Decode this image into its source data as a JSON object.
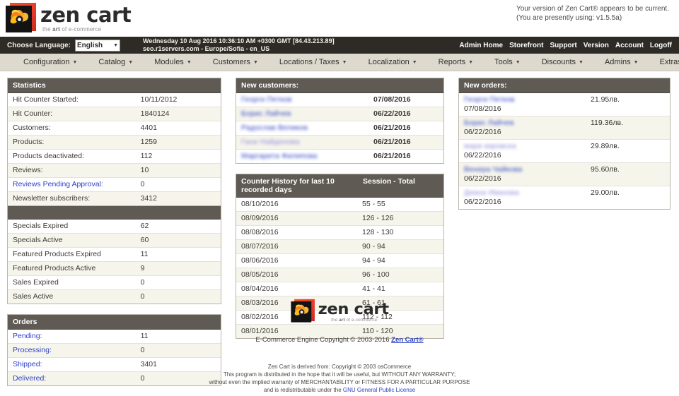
{
  "branding": {
    "name": "zen cart",
    "tagline_plain1": "the ",
    "tagline_bold": "art",
    "tagline_plain2": " of e-commerce",
    "logo_icon": "zencart-spiral-logo"
  },
  "version_notice": {
    "line1": "Your version of Zen Cart® appears to be current.",
    "line2": "(You are presently using: v1.5.5a)"
  },
  "adminbar": {
    "language_label": "Choose Language:",
    "language_value": "English",
    "datetime_line1": "Wednesday 10 Aug 2016 10:36:10 AM +0300 GMT [84.43.213.89]",
    "datetime_line2": "seo.r1servers.com - Europe/Sofia - en_US",
    "links": [
      {
        "label": "Admin Home"
      },
      {
        "label": "Storefront"
      },
      {
        "label": "Support"
      },
      {
        "label": "Version"
      },
      {
        "label": "Account"
      },
      {
        "label": "Logoff"
      }
    ]
  },
  "menu": [
    {
      "label": "Configuration"
    },
    {
      "label": "Catalog"
    },
    {
      "label": "Modules"
    },
    {
      "label": "Customers"
    },
    {
      "label": "Locations / Taxes"
    },
    {
      "label": "Localization"
    },
    {
      "label": "Reports"
    },
    {
      "label": "Tools"
    },
    {
      "label": "Discounts"
    },
    {
      "label": "Admins"
    },
    {
      "label": "Extras"
    }
  ],
  "statistics": {
    "title": "Statistics",
    "rows": [
      {
        "label": "Hit Counter Started:",
        "value": "10/11/2012",
        "link": false
      },
      {
        "label": "Hit Counter:",
        "value": "1840124",
        "link": false
      },
      {
        "label": "Customers:",
        "value": "4401",
        "link": false
      },
      {
        "label": "Products:",
        "value": "1259",
        "link": false
      },
      {
        "label": "Products deactivated:",
        "value": "112",
        "link": false
      },
      {
        "label": "Reviews:",
        "value": "10",
        "link": false
      },
      {
        "label": "Reviews Pending Approval:",
        "value": "0",
        "link": true
      },
      {
        "label": "Newsletter subscribers:",
        "value": "3412",
        "link": false
      }
    ]
  },
  "specials": {
    "title": "",
    "rows": [
      {
        "label": "Specials Expired",
        "value": "62",
        "link": false
      },
      {
        "label": "Specials Active",
        "value": "60",
        "link": false
      },
      {
        "label": "Featured Products Expired",
        "value": "11",
        "link": false
      },
      {
        "label": "Featured Products Active",
        "value": "9",
        "link": false
      },
      {
        "label": "Sales Expired",
        "value": "0",
        "link": false
      },
      {
        "label": "Sales Active",
        "value": "0",
        "link": false
      }
    ]
  },
  "orders_panel": {
    "title": "Orders",
    "rows": [
      {
        "label": "Pending:",
        "value": "11",
        "link": true
      },
      {
        "label": "Processing:",
        "value": "0",
        "link": true
      },
      {
        "label": "Shipped:",
        "value": "3401",
        "link": true
      },
      {
        "label": "Delivered:",
        "value": "0",
        "link": true
      }
    ]
  },
  "new_customers": {
    "title": "New customers:",
    "rows": [
      {
        "name": "Георги Петков",
        "date": "07/08/2016"
      },
      {
        "name": "Борис Лайчев",
        "date": "06/22/2016"
      },
      {
        "name": "Радослав Великов",
        "date": "06/21/2016"
      },
      {
        "name": "Гани Найденова",
        "date": "06/21/2016"
      },
      {
        "name": "Маргарита Филипова",
        "date": "06/21/2016"
      }
    ]
  },
  "counter_history": {
    "title": "Counter History for last 10 recorded days",
    "col_right": "Session - Total",
    "rows": [
      {
        "date": "08/10/2016",
        "value": "55 - 55"
      },
      {
        "date": "08/09/2016",
        "value": "126 - 126"
      },
      {
        "date": "08/08/2016",
        "value": "128 - 130"
      },
      {
        "date": "08/07/2016",
        "value": "90 - 94"
      },
      {
        "date": "08/06/2016",
        "value": "94 - 94"
      },
      {
        "date": "08/05/2016",
        "value": "96 - 100"
      },
      {
        "date": "08/04/2016",
        "value": "41 - 41"
      },
      {
        "date": "08/03/2016",
        "value": "61 - 61"
      },
      {
        "date": "08/02/2016",
        "value": "112 - 112"
      },
      {
        "date": "08/01/2016",
        "value": "110 - 120"
      }
    ]
  },
  "new_orders": {
    "title": "New orders:",
    "rows": [
      {
        "name": "Георги Петков",
        "date": "07/08/2016",
        "amount": "21.95лв."
      },
      {
        "name": "Борис Лайчев",
        "date": "06/22/2016",
        "amount": "119.36лв."
      },
      {
        "name": "мари кировска",
        "date": "06/22/2016",
        "amount": "29.89лв."
      },
      {
        "name": "Венера Чайкова",
        "date": "06/22/2016",
        "amount": "95.60лв."
      },
      {
        "name": "Диана Иванова",
        "date": "06/22/2016",
        "amount": "29.00лв."
      }
    ]
  },
  "footer": {
    "copyright_pre": "E-Commerce Engine Copyright © 2003-2016 ",
    "copyright_link": "Zen Cart®",
    "legal_line1": "Zen Cart is derived from: Copyright © 2003 osCommerce",
    "legal_line2": "This program is distributed in the hope that it will be useful, but WITHOUT ANY WARRANTY;",
    "legal_line3": "without even the implied warranty of MERCHANTABILITY or FITNESS FOR A PARTICULAR PURPOSE",
    "legal_line4_pre": "and is redistributable under the ",
    "legal_line4_link": "GNU General Public License"
  },
  "colors": {
    "dark_bar": "#2e2b27",
    "menu_bar": "#ddd9ce",
    "panel_header": "#5f5b54",
    "row_alt": "#f6f5ec",
    "link": "#2b3fc4",
    "logo_red": "#e8392a",
    "logo_orange": "#f6a623"
  }
}
